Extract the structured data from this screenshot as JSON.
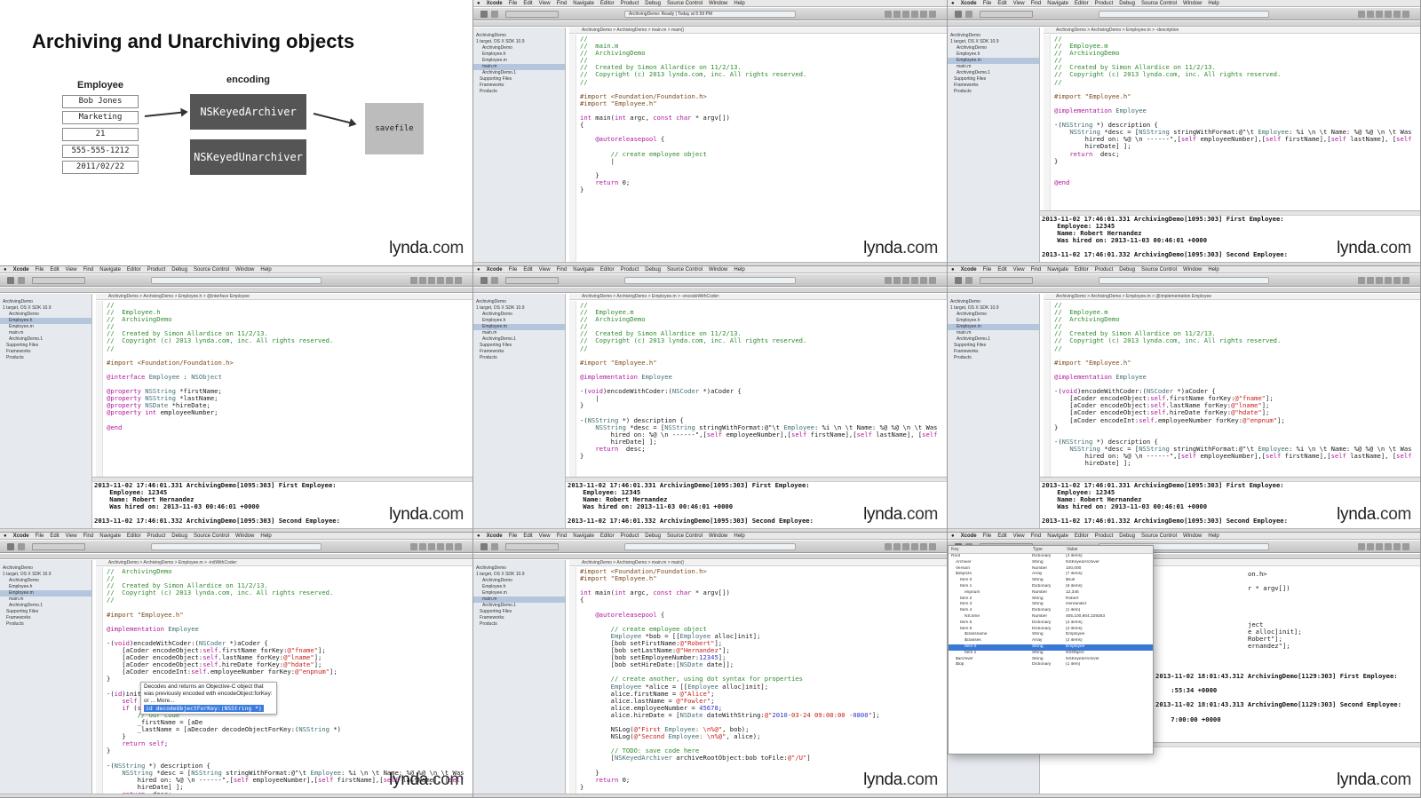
{
  "watermark": {
    "brand": "lynda",
    "suffix": ".com"
  },
  "menubar": {
    "app": "Xcode",
    "items": [
      "File",
      "Edit",
      "View",
      "Find",
      "Navigate",
      "Editor",
      "Product",
      "Debug",
      "Source Control",
      "Window",
      "Help"
    ]
  },
  "slide": {
    "title": "Archiving and Unarchiving objects",
    "employee_heading": "Employee",
    "employee_fields": [
      "Bob Jones",
      "Marketing",
      "21",
      "555-555-1212",
      "2011/02/22"
    ],
    "encoding_heading": "encoding",
    "archiver": "NSKeyedArchiver",
    "unarchiver": "NSKeyedUnarchiver",
    "savefile": "savefile"
  },
  "navigator": {
    "items": [
      "ArchivingDemo",
      "1 target, OS X SDK 10.9",
      "ArchivingDemo",
      "Employee.h",
      "Employee.m",
      "main.m",
      "ArchivingDemo.1",
      "Supporting Files",
      "Frameworks",
      "Products"
    ]
  },
  "console": {
    "lines": [
      "2013-11-02 17:46:01.331 ArchivingDemo[1095:303] First Employee:",
      "    Employee: 12345",
      "    Name: Robert Hernandez",
      "    Was hired on: 2013-11-03 00:46:01 +0000",
      "",
      "2013-11-02 17:46:01.332 ArchivingDemo[1095:303] Second Employee:"
    ]
  },
  "screens": {
    "s2": {
      "jump": "ArchivingDemo  >  ArchivingDemo  >  main.m  >  main()",
      "status": "ArchivingDemo: Ready  |  Today at 5:59 PM"
    },
    "s3": {
      "jump": "ArchivingDemo  >  ArchivingDemo  >  Employee.m  >  -description"
    },
    "s4": {
      "jump": "ArchivingDemo  >  ArchivingDemo  >  Employee.h  >  @interface Employee"
    },
    "s5": {
      "jump": "ArchivingDemo  >  ArchivingDemo  >  Employee.m  >  -encodeWithCoder:"
    },
    "s6": {
      "jump": "ArchivingDemo  >  ArchivingDemo  >  Employee.m  >  @implementation Employee"
    },
    "s7": {
      "jump": "ArchivingDemo  >  ArchivingDemo  >  Employee.m  >  -initWithCoder:",
      "popup_text": "Decodes and returns an Objective-C object that was previously encoded with encodeObject:forKey: or ... More...",
      "popup_selection": "id decodeObjectForKey:(NSString *)"
    },
    "s8": {
      "jump": "ArchivingDemo  >  ArchivingDemo  >  main.m  >  main()"
    },
    "s9": {
      "jump": "bob.plist  >  No Selection",
      "plist_headers": [
        "Key",
        "Type",
        "Value"
      ],
      "plist_rows": [
        [
          "Root",
          "Dictionary",
          "(4 items)"
        ],
        [
          "Archiver",
          "String",
          "NSKeyedArchiver"
        ],
        [
          "Version",
          "Number",
          "100,000"
        ],
        [
          "$objects",
          "Array",
          "(7 items)"
        ],
        [
          "Item 0",
          "String",
          "$null"
        ],
        [
          "Item 1",
          "Dictionary",
          "(6 items)"
        ],
        [
          "enpnum",
          "Number",
          "12,345"
        ],
        [
          "Item 2",
          "String",
          "Robert"
        ],
        [
          "Item 3",
          "String",
          "Hernandez"
        ],
        [
          "Item 4",
          "Dictionary",
          "(1 item)"
        ],
        [
          "NS.time",
          "Number",
          "405,100,804.229263"
        ],
        [
          "Item 5",
          "Dictionary",
          "(2 items)"
        ],
        [
          "Item 6",
          "Dictionary",
          "(2 items)"
        ],
        [
          "$classname",
          "String",
          "Employee"
        ],
        [
          "$classes",
          "Array",
          "(2 items)"
        ],
        [
          "Item 0",
          "String",
          "Employee"
        ],
        [
          "Item 1",
          "String",
          "NSObject"
        ],
        [
          "$archiver",
          "String",
          "NSKeyedArchiver"
        ],
        [
          "$top",
          "Dictionary",
          "(1 item)"
        ]
      ],
      "console": [
        "2013-11-02 18:01:43.312 ArchivingDemo[1129:303] First Employee:",
        "",
        "    :55:34 +0000",
        "",
        "2013-11-02 18:01:43.313 ArchivingDemo[1129:303] Second Employee:",
        "",
        "    7:00:00 +0000"
      ]
    }
  },
  "code": {
    "main_header": [
      "//",
      "//  main.m",
      "//  ArchivingDemo",
      "//",
      "//  Created by Simon Allardice on 11/2/13.",
      "//  Copyright (c) 2013 lynda.com, inc. All rights reserved.",
      "//",
      "",
      "#import <Foundation/Foundation.h>",
      "#import \"Employee.h\"",
      "",
      "int main(int argc, const char * argv[])",
      "{",
      "",
      "    @autoreleasepool {",
      "",
      "        // create employee object",
      "        |",
      "",
      "    }",
      "    return 0;",
      "}"
    ],
    "emp_m_desc": [
      "//",
      "//  Employee.m",
      "//  ArchivingDemo",
      "//",
      "//  Created by Simon Allardice on 11/2/13.",
      "//  Copyright (c) 2013 lynda.com, inc. All rights reserved.",
      "//",
      "",
      "#import \"Employee.h\"",
      "",
      "@implementation Employee",
      "",
      "-(NSString *) description {",
      "    NSString *desc = [NSString stringWithFormat:@\"\\t Employee: %i \\n \\t Name: %@ %@ \\n \\t Was",
      "        hired on: %@ \\n ------\",[self employeeNumber],[self firstName],[self lastName], [self",
      "        hireDate] ];",
      "    return  desc;",
      "}",
      "",
      "",
      "@end"
    ],
    "emp_h": [
      "//",
      "//  Employee.h",
      "//  ArchivingDemo",
      "//",
      "//  Created by Simon Allardice on 11/2/13.",
      "//  Copyright (c) 2013 lynda.com, inc. All rights reserved.",
      "//",
      "",
      "#import <Foundation/Foundation.h>",
      "",
      "@interface Employee : NSObject",
      "",
      "@property NSString *firstName;",
      "@property NSString *lastName;",
      "@property NSDate *hireDate;",
      "@property int employeeNumber;",
      "",
      "@end"
    ],
    "emp_m_encode_empty": [
      "//",
      "//  Employee.m",
      "//  ArchivingDemo",
      "//",
      "//  Created by Simon Allardice on 11/2/13.",
      "//  Copyright (c) 2013 lynda.com, inc. All rights reserved.",
      "//",
      "",
      "#import \"Employee.h\"",
      "",
      "@implementation Employee",
      "",
      "-(void)encodeWithCoder:(NSCoder *)aCoder {",
      "    |",
      "}",
      "",
      "-(NSString *) description {",
      "    NSString *desc = [NSString stringWithFormat:@\"\\t Employee: %i \\n \\t Name: %@ %@ \\n \\t Was",
      "        hired on: %@ \\n ------\",[self employeeNumber],[self firstName],[self lastName], [self",
      "        hireDate] ];",
      "    return  desc;",
      "}"
    ],
    "emp_m_encode_full": [
      "//",
      "//  Employee.m",
      "//  ArchivingDemo",
      "//",
      "//  Created by Simon Allardice on 11/2/13.",
      "//  Copyright (c) 2013 lynda.com, inc. All rights reserved.",
      "//",
      "",
      "#import \"Employee.h\"",
      "",
      "@implementation Employee",
      "",
      "-(void)encodeWithCoder:(NSCoder *)aCoder {",
      "    [aCoder encodeObject:self.firstName forKey:@\"fname\"];",
      "    [aCoder encodeObject:self.lastName forKey:@\"lname\"];",
      "    [aCoder encodeObject:self.hireDate forKey:@\"hdate\"];",
      "    [aCoder encodeInt:self.employeeNumber forKey:@\"enpnum\"];",
      "}",
      "",
      "-(NSString *) description {",
      "    NSString *desc = [NSString stringWithFormat:@\"\\t Employee: %i \\n \\t Name: %@ %@ \\n \\t Was",
      "        hired on: %@ \\n ------\",[self employeeNumber],[self firstName],[self lastName], [self",
      "        hireDate] ];"
    ],
    "emp_m_init": [
      "//  ArchivingDemo",
      "//",
      "//  Created by Simon Allardice on 11/2/13.",
      "//  Copyright (c) 2013 lynda.com, inc. All rights reserved.",
      "//",
      "",
      "#import \"Employee.h\"",
      "",
      "@implementation Employee",
      "",
      "-(void)encodeWithCoder:(NSCoder *)aCoder {",
      "    [aCoder encodeObject:self.firstName forKey:@\"fname\"];",
      "    [aCoder encodeObject:self.lastName forKey:@\"lname\"];",
      "    [aCoder encodeObject:self.hireDate forKey:@\"hdate\"];",
      "    [aCoder encodeInt:self.employeeNumber forKey:@\"enpnum\"];",
      "}",
      "",
      "-(id)initWithCoder:(NSCoder",
      "    self = [super init];",
      "    if (self) {",
      "        // our code",
      "        _firstName = [aDe",
      "        _lastName = [aDecoder decodeObjectForKey:(NSString *)",
      "    }",
      "    return self;",
      "}",
      "",
      "-(NSString *) description {",
      "    NSString *desc = [NSString stringWithFormat:@\"\\t Employee: %i \\n \\t Name: %@ %@ \\n \\t Was",
      "        hired on: %@ \\n ------\",[self employeeNumber],[self firstName],[self lastName], [self",
      "        hireDate] ];",
      "    return  desc;"
    ],
    "main_full": [
      "#import <Foundation/Foundation.h>",
      "#import \"Employee.h\"",
      "",
      "int main(int argc, const char * argv[])",
      "{",
      "",
      "    @autoreleasepool {",
      "",
      "        // create employee object",
      "        Employee *bob = [[Employee alloc]init];",
      "        [bob setFirstName:@\"Robert\"];",
      "        [bob setLastName:@\"Hernandez\"];",
      "        [bob setEmployeeNumber:12345];",
      "        [bob setHireDate:[NSDate date]];",
      "",
      "        // create another, using dot syntax for properties",
      "        Employee *alice = [[Employee alloc]init];",
      "        alice.firstName = @\"Alice\";",
      "        alice.lastName = @\"Fowler\";",
      "        alice.employeeNumber = 45678;",
      "        alice.hireDate = [NSDate dateWithString:@\"2010-03-24 09:00:00 -0800\"];",
      "",
      "        NSLog(@\"First Employee: \\n%@\", bob);",
      "        NSLog(@\"Second Employee: \\n%@\", alice);",
      "",
      "        // TODO: save code here",
      "        [NSKeyedArchiver archiveRootObject:bob toFile:@\"/U\"]",
      "",
      "    }",
      "    return 0;",
      "}"
    ],
    "main_right": [
      "on.h>",
      "",
      "r * argv[])",
      "",
      "",
      "",
      "",
      "ject",
      "e alloc]init];",
      "Robert\"];",
      "ernandez\"];"
    ]
  }
}
